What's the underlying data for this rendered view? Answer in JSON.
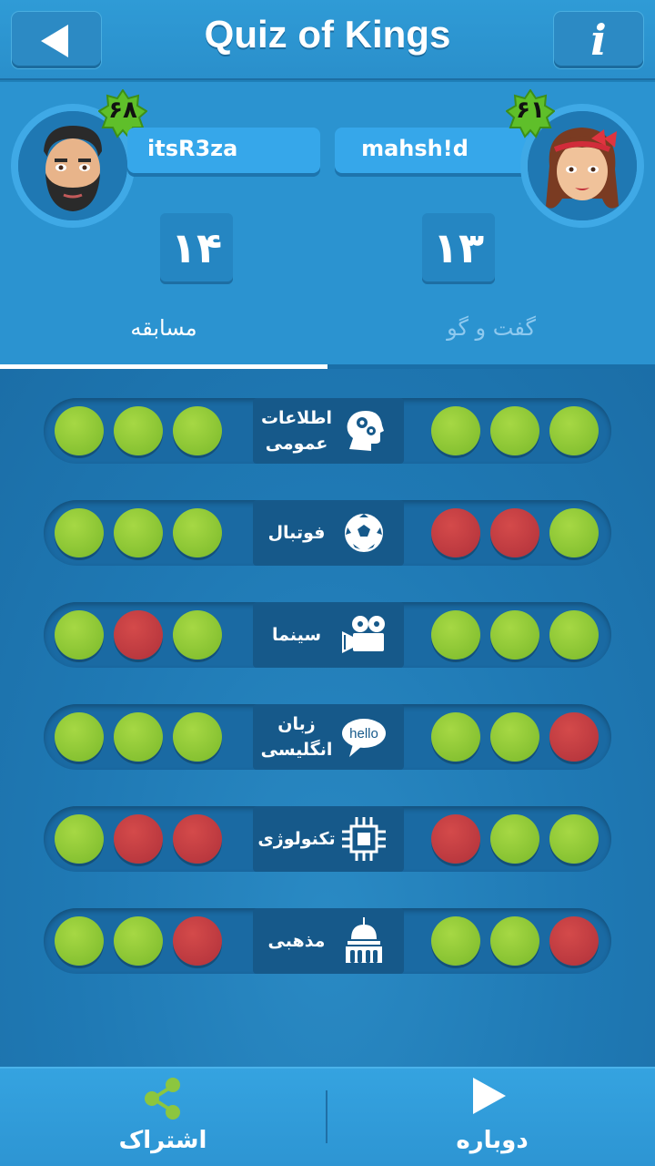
{
  "header": {
    "title": "Quiz of Kings",
    "back_icon": "back-arrow-icon",
    "info_icon": "info-icon",
    "info_glyph": "i"
  },
  "players": {
    "left": {
      "name": "itsR3za",
      "level": "۶۸",
      "score": "۱۴"
    },
    "right": {
      "name": "mahsh!d",
      "level": "۶۱",
      "score": "۱۳"
    }
  },
  "tabs": [
    {
      "label": "مسابقه",
      "active": true
    },
    {
      "label": "گفت و گو",
      "active": false
    }
  ],
  "categories": [
    {
      "name": "اطلاعات عمومی",
      "icon": "brain-gears-icon",
      "left": [
        "green",
        "green",
        "green"
      ],
      "right": [
        "green",
        "green",
        "green"
      ]
    },
    {
      "name": "فوتبال",
      "icon": "soccer-ball-icon",
      "left": [
        "green",
        "green",
        "green"
      ],
      "right": [
        "red",
        "red",
        "green"
      ]
    },
    {
      "name": "سینما",
      "icon": "movie-camera-icon",
      "left": [
        "green",
        "red",
        "green"
      ],
      "right": [
        "green",
        "green",
        "green"
      ]
    },
    {
      "name": "زبان انگلیسی",
      "icon": "hello-speech-bubble-icon",
      "icon_text": "hello",
      "left": [
        "green",
        "green",
        "green"
      ],
      "right": [
        "green",
        "green",
        "red"
      ]
    },
    {
      "name": "تکنولوژی",
      "icon": "microchip-icon",
      "left": [
        "green",
        "red",
        "red"
      ],
      "right": [
        "red",
        "green",
        "green"
      ]
    },
    {
      "name": "مذهبی",
      "icon": "mosque-icon",
      "left": [
        "green",
        "green",
        "red"
      ],
      "right": [
        "green",
        "green",
        "red"
      ]
    }
  ],
  "colors": {
    "green": "#8cc63f",
    "red": "#c0393f",
    "accent": "#2b93d0"
  },
  "bottom": {
    "share_label": "اشتراک",
    "share_icon": "share-icon",
    "replay_label": "دوباره",
    "replay_icon": "play-icon"
  }
}
